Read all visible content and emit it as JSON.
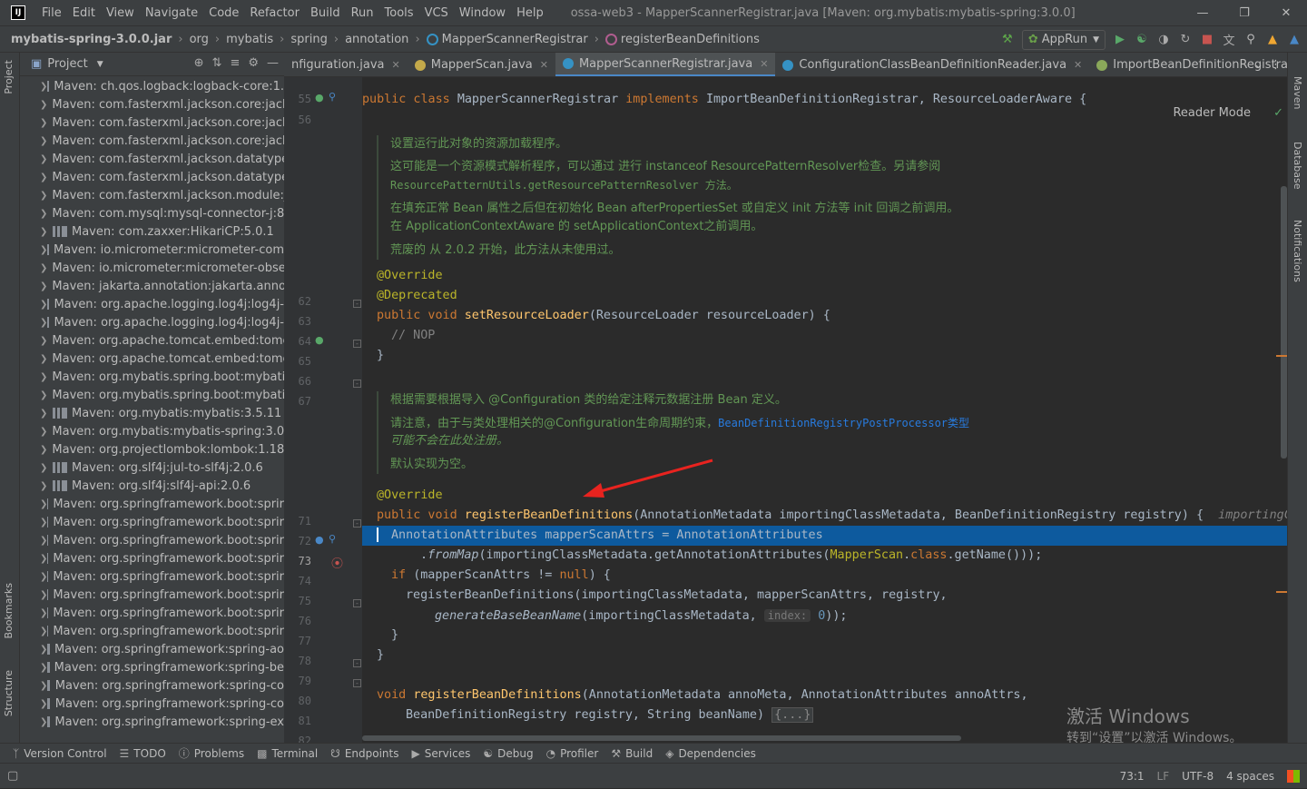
{
  "titlebar": {
    "app_icon": "IJ",
    "menus": [
      "File",
      "Edit",
      "View",
      "Navigate",
      "Code",
      "Refactor",
      "Build",
      "Run",
      "Tools",
      "VCS",
      "Window",
      "Help"
    ],
    "title": "ossa-web3 - MapperScannerRegistrar.java [Maven: org.mybatis:mybatis-spring:3.0.0]"
  },
  "breadcrumb": {
    "items": [
      "mybatis-spring-3.0.0.jar",
      "org",
      "mybatis",
      "spring",
      "annotation",
      "MapperScannerRegistrar",
      "registerBeanDefinitions"
    ]
  },
  "run_config": {
    "label": "AppRun"
  },
  "project_panel": {
    "title": "Project",
    "items": [
      "Maven: ch.qos.logback:logback-core:1.",
      "Maven: com.fasterxml.jackson.core:jack",
      "Maven: com.fasterxml.jackson.core:jack",
      "Maven: com.fasterxml.jackson.core:jack",
      "Maven: com.fasterxml.jackson.datatype",
      "Maven: com.fasterxml.jackson.datatype",
      "Maven: com.fasterxml.jackson.module:ja",
      "Maven: com.mysql:mysql-connector-j:8.",
      "Maven: com.zaxxer:HikariCP:5.0.1",
      "Maven: io.micrometer:micrometer-com",
      "Maven: io.micrometer:micrometer-obse",
      "Maven: jakarta.annotation:jakarta.annot",
      "Maven: org.apache.logging.log4j:log4j-",
      "Maven: org.apache.logging.log4j:log4j-",
      "Maven: org.apache.tomcat.embed:tomc",
      "Maven: org.apache.tomcat.embed:tomc",
      "Maven: org.mybatis.spring.boot:mybati",
      "Maven: org.mybatis.spring.boot:mybati",
      "Maven: org.mybatis:mybatis:3.5.11",
      "Maven: org.mybatis:mybatis-spring:3.0.",
      "Maven: org.projectlombok:lombok:1.18",
      "Maven: org.slf4j:jul-to-slf4j:2.0.6",
      "Maven: org.slf4j:slf4j-api:2.0.6",
      "Maven: org.springframework.boot:sprir",
      "Maven: org.springframework.boot:sprir",
      "Maven: org.springframework.boot:sprir",
      "Maven: org.springframework.boot:sprir",
      "Maven: org.springframework.boot:sprir",
      "Maven: org.springframework.boot:sprir",
      "Maven: org.springframework.boot:sprir",
      "Maven: org.springframework.boot:sprir",
      "Maven: org.springframework:spring-ao",
      "Maven: org.springframework:spring-be",
      "Maven: org.springframework:spring-co",
      "Maven: org.springframework:spring-co",
      "Maven: org.springframework:spring-ex"
    ]
  },
  "left_strip": {
    "project": "Project",
    "bookmarks": "Bookmarks",
    "structure": "Structure"
  },
  "right_strip": {
    "maven": "Maven",
    "database": "Database",
    "notifications": "Notifications"
  },
  "tabs": [
    {
      "label": "nfiguration.java",
      "color": "#3592c4",
      "active": false
    },
    {
      "label": "MapperScan.java",
      "color": "#c3a94a",
      "active": false
    },
    {
      "label": "MapperScannerRegistrar.java",
      "color": "#3592c4",
      "active": true
    },
    {
      "label": "ConfigurationClassBeanDefinitionReader.java",
      "color": "#3592c4",
      "active": false
    },
    {
      "label": "ImportBeanDefinitionRegistrar.java",
      "color": "#c3a94a",
      "active": false
    }
  ],
  "editor": {
    "reader_mode": "Reader Mode",
    "line_numbers": [
      "55",
      "56",
      "62",
      "63",
      "64",
      "65",
      "66",
      "67",
      "71",
      "72",
      "73",
      "74",
      "75",
      "76",
      "77",
      "78",
      "79",
      "80",
      "81",
      "82",
      "147"
    ],
    "doc1": [
      "设置运行此对象的资源加载程序。",
      "这可能是一个资源模式解析程序，可以通过 进行 instanceof ResourcePatternResolver检查。另请参阅",
      "ResourcePatternUtils.getResourcePatternResolver 方法。",
      "在填充正常 Bean 属性之后但在初始化 Bean afterPropertiesSet 或自定义 init 方法等 init 回调之前调用。",
      "在 ApplicationContextAware 的 setApplicationContext之前调用。",
      "荒废的 从 2.0.2 开始，此方法从未使用过。"
    ],
    "doc2": [
      "根据需要根据导入 @Configuration 类的给定注释元数据注册 Bean 定义。",
      "请注意，由于与类处理相关的@Configuration生命周期约束，",
      "BeanDefinitionRegistryPostProcessor类型",
      "可能不会在此处注册。",
      "默认实现为空。"
    ],
    "inlay_hint": "index:",
    "inline_hint_right": "importingC",
    "collapsed": "{...}"
  },
  "bottom_tools": [
    "Version Control",
    "TODO",
    "Problems",
    "Terminal",
    "Endpoints",
    "Services",
    "Debug",
    "Profiler",
    "Build",
    "Dependencies"
  ],
  "status": {
    "position": "73:1",
    "line_sep": "LF",
    "encoding": "UTF-8",
    "indent": "4 spaces"
  },
  "watermark": {
    "line1": "激活 Windows",
    "line2": "转到“设置”以激活 Windows。"
  },
  "colors": {
    "accent": "#4a88c7",
    "selection": "#0d5a9e",
    "arrow": "#e8231f"
  }
}
